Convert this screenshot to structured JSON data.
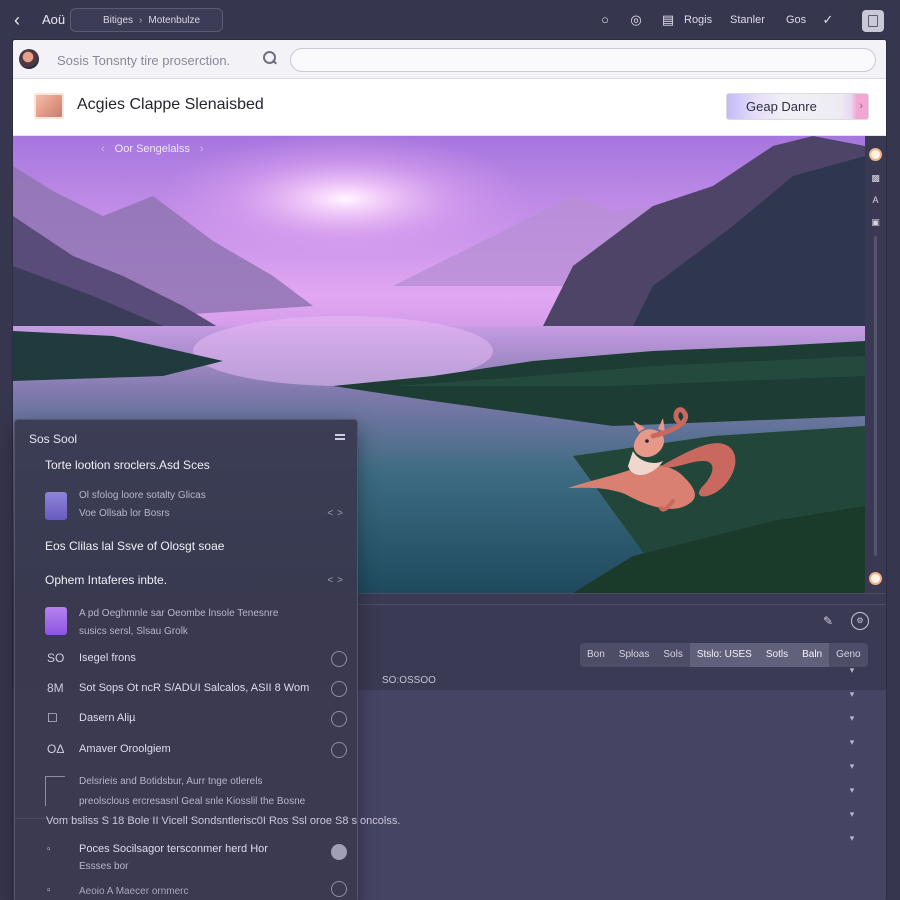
{
  "topbar": {
    "app_name": "Aoü",
    "crumb_a": "Bitiges",
    "crumb_b": "Motenbulze",
    "link_1": "Rogis",
    "link_2": "Stanler",
    "link_3": "Gos"
  },
  "search": {
    "placeholder": "Sosis Tonsnty tire proserction."
  },
  "header": {
    "title": "Acgies Clappe Slenaisbed",
    "cta_label": "Geap Danre"
  },
  "hero": {
    "caption": "Oor Sengelalss"
  },
  "toolbar": {
    "segments": [
      "Bon",
      "Sploas",
      "Sols",
      "Stslo: USES",
      "Sotls",
      "Baln",
      "Geno"
    ],
    "meta": "SO:OSSOO"
  },
  "panel": {
    "title": "Sos Sool",
    "section_1": "Torte lootion sroclers.Asd Sces",
    "item_1_line_1": "Ol sfolog loore sotalty Glicas",
    "item_1_line_2": "Voe Ollsab lor Bosrs",
    "section_2": "Eos   Clilas lal Ssve of Olosgt soae",
    "section_3": "Ophem Intaferes inbte.",
    "item_2_line_1": "A pd Oeghmnle sar Oeombe lnsole Tenesnre",
    "item_2_line_2": "susics sersl, Slsau Grolk",
    "opt_1_glyph": "SO",
    "opt_1_label": "Isegel frons",
    "opt_2_glyph": "8M",
    "opt_2_label": "Sot Sops Ot ncR S/ADUI Salcalos, ASII  8  Wom",
    "opt_3_glyph": "☐",
    "opt_3_label": "Dasern Aliµ",
    "opt_4_glyph": "OΔ",
    "opt_4_label": "Amaver Oroolgiem",
    "note_line_1": "Delsrieis and Botidsbur, Aurr tnge otlerels",
    "note_line_2": "preolsclous ercresasnl  Geal snle Kiosslil the Bosne",
    "wide_line": "Vom   bsliss  S 18 Bole II Vicell Sondsntlerisc0I Ros Ssl oroe S8 s oncolss.",
    "opt_5_label": "Poces  Socilsagor tersconmer herd Hor",
    "opt_5_sub": "Essses bor",
    "opt_6_label": "Aeoio A Maecer ornmerc"
  },
  "colors": {
    "background": "#37364f",
    "accent": "#b683f0",
    "sun": "#f4d3f7"
  }
}
